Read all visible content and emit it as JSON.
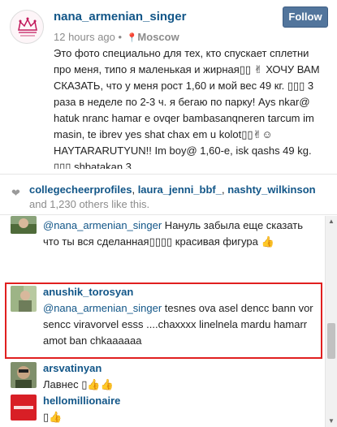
{
  "post": {
    "username": "nana_armenian_singer",
    "time": "12 hours ago",
    "location_separator": "•",
    "location": "Moscow",
    "follow_label": "Follow",
    "caption": "Это фото специально для тех, кто спускает сплетни про меня, типо я маленькая и жирная▯▯ ✌ ХОЧУ ВАМ СКАЗАТЬ, что у меня рост 1,60 и мой вес 49 кг. ▯▯▯ 3 раза в неделе по 2-3 ч. я бегаю по парку! Ays nkar@ hatuk nranc hamar e ovqer bambasanqneren tarcum im masin, te ibrev yes shat chax em u kolot▯▯✌☺ HAYTARARUTYUN!! Im boy@ 1,60-e, isk qashs 49 kg. ▯▯▯ shbatakan 3"
  },
  "likes": {
    "users": [
      "collegecheerprofiles",
      "laura_jenni_bbf_",
      "nashty_wilkinson"
    ],
    "rest": "and 1,230 others like this."
  },
  "comments": [
    {
      "user": "",
      "mention": "@nana_armenian_singer",
      "text": " Нануль забыла еще сказать что ты вся сделанная▯▯▯▯ красивая фигура 👍"
    },
    {
      "user": "anushik_torosyan",
      "mention": "@nana_armenian_singer",
      "text": " tesnes ova asel dencc bann vor sencc viravorvel esss ....chaxxxx linelnela mardu hamarr amot ban chkaaaaaa"
    },
    {
      "user": "arsvatinyan",
      "mention": "",
      "text": "Лавнес ▯👍👍"
    },
    {
      "user": "hellomillionaire",
      "mention": "",
      "text": "▯👍"
    }
  ],
  "colors": {
    "link": "#125688",
    "follow_button": "#52759c",
    "highlight_border": "#e02020"
  }
}
